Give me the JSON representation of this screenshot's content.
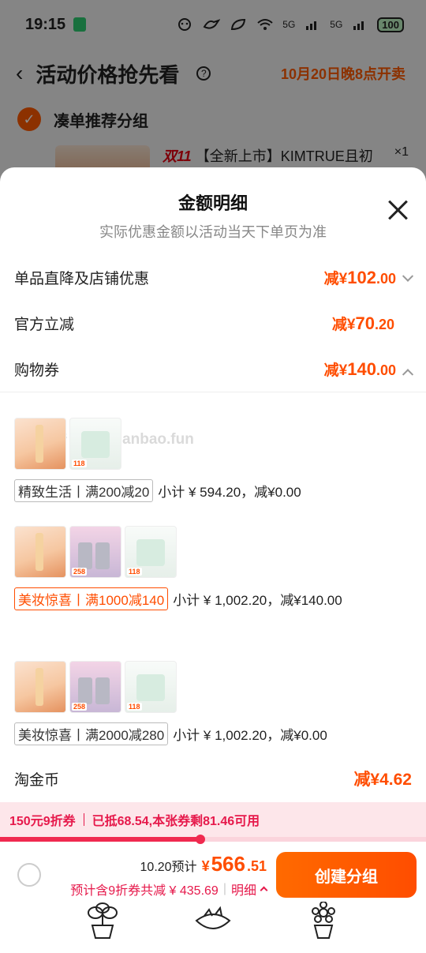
{
  "status_bar": {
    "time": "19:15",
    "battery": "100",
    "signal_labels": [
      "5G",
      "5G"
    ]
  },
  "background_page": {
    "title": "活动价格抢先看",
    "sale_time": "10月20日晚8点开卖",
    "group_title": "凑单推荐分组",
    "product_prefix": "双11",
    "product_name": "【全新上市】KIMTRUE且初",
    "product_qty": "×1"
  },
  "sheet": {
    "title": "金额明细",
    "subtitle": "实际优惠金额以活动当天下单页为准",
    "rows": [
      {
        "label": "单品直降及店铺优惠",
        "prefix": "减¥",
        "int": "102",
        "dec": ".00",
        "chevron": "down"
      },
      {
        "label": "官方立减",
        "prefix": "减¥",
        "int": "70",
        "dec": ".20",
        "chevron": "none"
      },
      {
        "label": "购物券",
        "prefix": "减¥",
        "int": "140",
        "dec": ".00",
        "chevron": "up"
      }
    ],
    "watermark": "线报酷 www.xianbao.fun",
    "coupon_groups": [
      {
        "tag": "精致生活丨满200减20",
        "active": false,
        "subtotal": "小计 ¥ 594.20，减¥0.00",
        "thumbs": [
          "t1",
          "t2"
        ],
        "thumb_tags": [
          "",
          "118"
        ]
      },
      {
        "tag": "美妆惊喜丨满1000减140",
        "active": true,
        "subtotal": "小计 ¥ 1,002.20，减¥140.00",
        "thumbs": [
          "t1",
          "t3",
          "t2"
        ],
        "thumb_tags": [
          "",
          "258",
          "118"
        ]
      },
      {
        "tag": "美妆惊喜丨满2000减280",
        "active": false,
        "subtotal": "小计 ¥ 1,002.20，减¥0.00",
        "thumbs": [
          "t1",
          "t3",
          "t2"
        ],
        "thumb_tags": [
          "",
          "258",
          "118"
        ]
      }
    ],
    "taojin": {
      "label": "淘金币",
      "value": "减¥4.62"
    }
  },
  "promo": {
    "left": "150元9折券",
    "right": "已抵68.54,本张券剩81.46可用",
    "progress": 0.47
  },
  "checkout": {
    "pre": "10.20预计",
    "yen": "¥",
    "int": "566",
    "dec": ".51",
    "sub": "预计含9折券共减 ¥ 435.69",
    "detail": "明细",
    "button": "创建分组"
  },
  "colors": {
    "accent": "#ff4d00",
    "promo": "#e6194b"
  }
}
